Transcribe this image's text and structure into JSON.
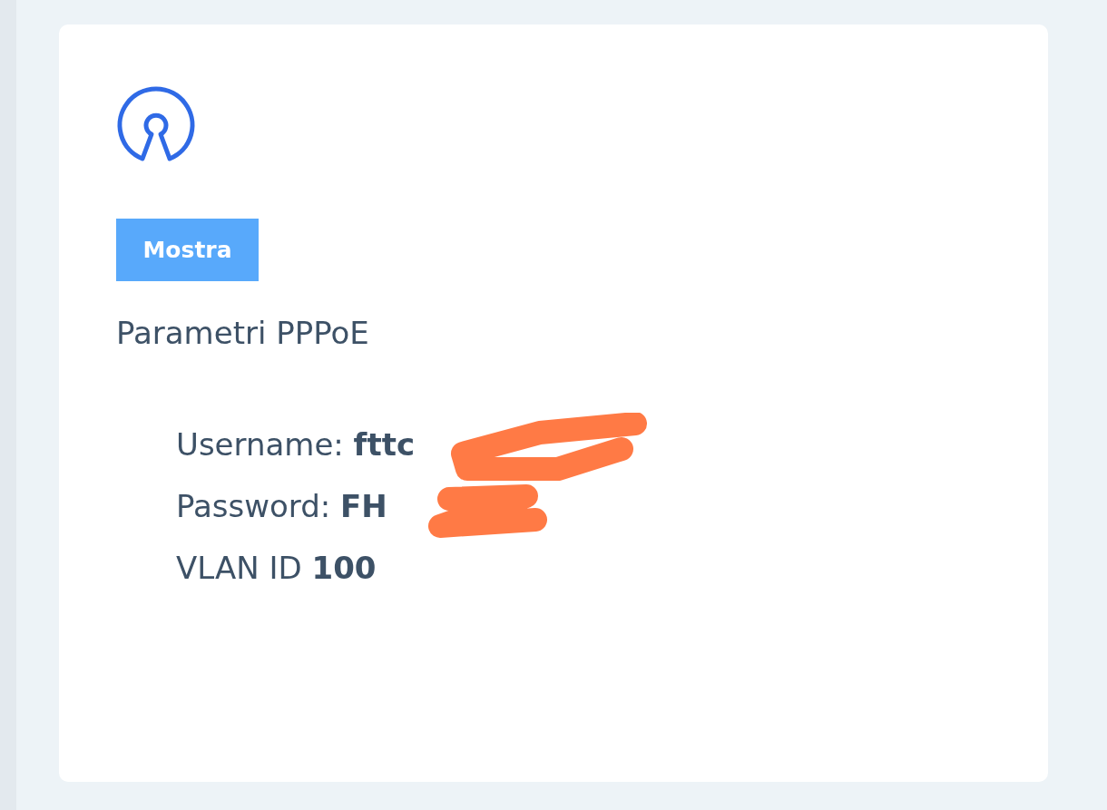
{
  "card": {
    "button": "Mostra",
    "heading": "Parametri PPPoE",
    "params": [
      {
        "label": "Username:",
        "value": "fttc"
      },
      {
        "label": "Password:",
        "value": "FH"
      },
      {
        "label": "VLAN ID",
        "value": "100"
      }
    ],
    "redaction_scribble": true
  }
}
